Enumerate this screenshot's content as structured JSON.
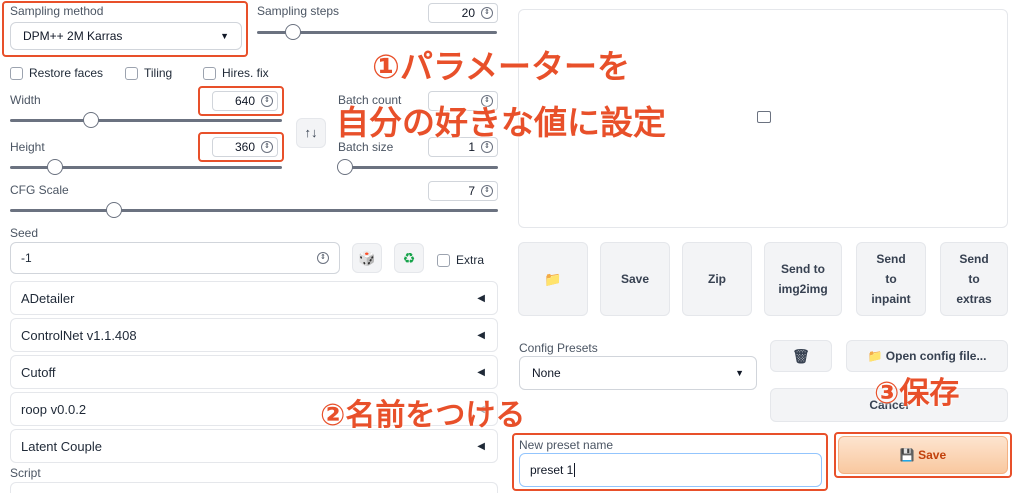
{
  "left": {
    "sampling_method": {
      "label": "Sampling method",
      "value": "DPM++ 2M Karras"
    },
    "sampling_steps": {
      "label": "Sampling steps",
      "value": "20",
      "fraction": 0.19
    },
    "checkboxes": [
      {
        "label": "Restore faces"
      },
      {
        "label": "Tiling"
      },
      {
        "label": "Hires. fix"
      }
    ],
    "width": {
      "label": "Width",
      "value": "640",
      "fraction": 0.29
    },
    "height": {
      "label": "Height",
      "value": "360",
      "fraction": 0.16
    },
    "batch_count": {
      "label": "Batch count"
    },
    "batch_size": {
      "label": "Batch size",
      "value": "1",
      "fraction": 0.0
    },
    "cfg_scale": {
      "label": "CFG Scale",
      "value": "7",
      "fraction": 0.22
    },
    "seed": {
      "label": "Seed",
      "value": "-1",
      "extra_label": "Extra"
    },
    "accordions": [
      "ADetailer",
      "ControlNet v1.1.408",
      "Cutoff",
      "roop v0.0.2",
      "Latent Couple"
    ],
    "script_label": "Script",
    "swap_icon": "↑↓"
  },
  "right": {
    "buttons": {
      "folder": "📁",
      "save": "Save",
      "zip": "Zip",
      "img2img": "Send to\nimg2img",
      "inpaint": "Send\nto\ninpaint",
      "extras": "Send\nto\nextras"
    },
    "config_presets": {
      "label": "Config Presets",
      "value": "None"
    },
    "trash_icon": "🗑",
    "open_config": "📁 Open config file...",
    "cancel": "Cancel",
    "new_preset": {
      "label": "New preset name",
      "value": "preset 1"
    },
    "save_preset": "💾 Save"
  },
  "annotations": {
    "step1_line1": "①パラメーターを",
    "step1_line2": "自分の好きな値に設定",
    "step2": "②名前をつける",
    "step3": "③保存"
  },
  "colors": {
    "annotation": "#e8502a",
    "save_button": "#fbd9bc"
  }
}
